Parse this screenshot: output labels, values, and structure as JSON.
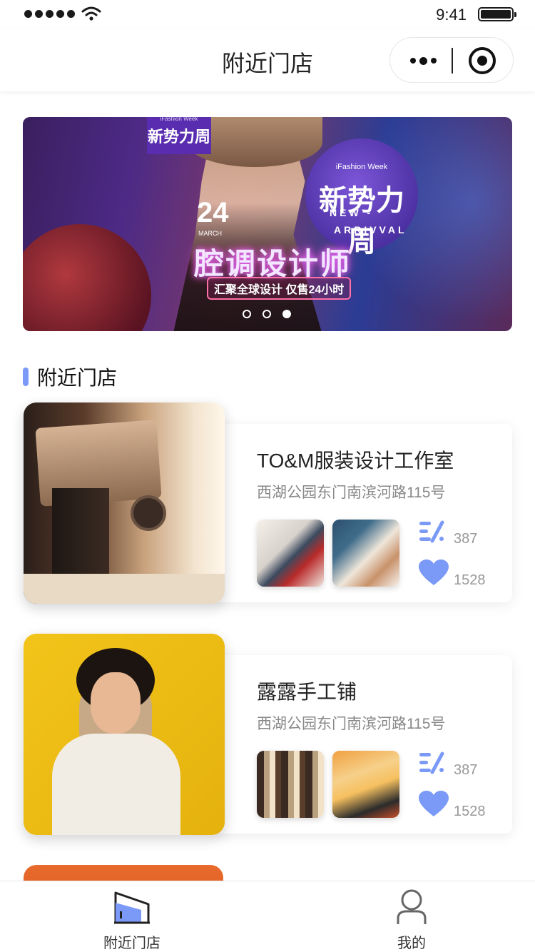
{
  "status_bar": {
    "time": "9:41"
  },
  "nav": {
    "title": "附近门店"
  },
  "banner": {
    "logo_small": "iFashion Week",
    "logo_text": "新势力周",
    "circle_sub": "iFashion Week",
    "circle_main": "新势力周",
    "new_line": "NEW -",
    "arrival_line": "ARRIVVAL",
    "date": "24",
    "month": "MARCH",
    "headline": "腔调设计师",
    "tag": "汇聚全球设计 仅售24小时",
    "slide_count": 3,
    "active_slide": 3
  },
  "section": {
    "title": "附近门店"
  },
  "shops": [
    {
      "name": "TO&M服装设计工作室",
      "address": "西湖公园东门南滨河路115号",
      "visits": "387",
      "likes": "1528"
    },
    {
      "name": "露露手工铺",
      "address": "西湖公园东门南滨河路115号",
      "visits": "387",
      "likes": "1528"
    }
  ],
  "colors": {
    "accent": "#7b9af7",
    "icon_blue": "#7b9af7"
  },
  "tabbar": {
    "items": [
      {
        "label": "附近门店",
        "icon": "store-icon",
        "active": true
      },
      {
        "label": "我的",
        "icon": "user-icon",
        "active": false
      }
    ]
  }
}
